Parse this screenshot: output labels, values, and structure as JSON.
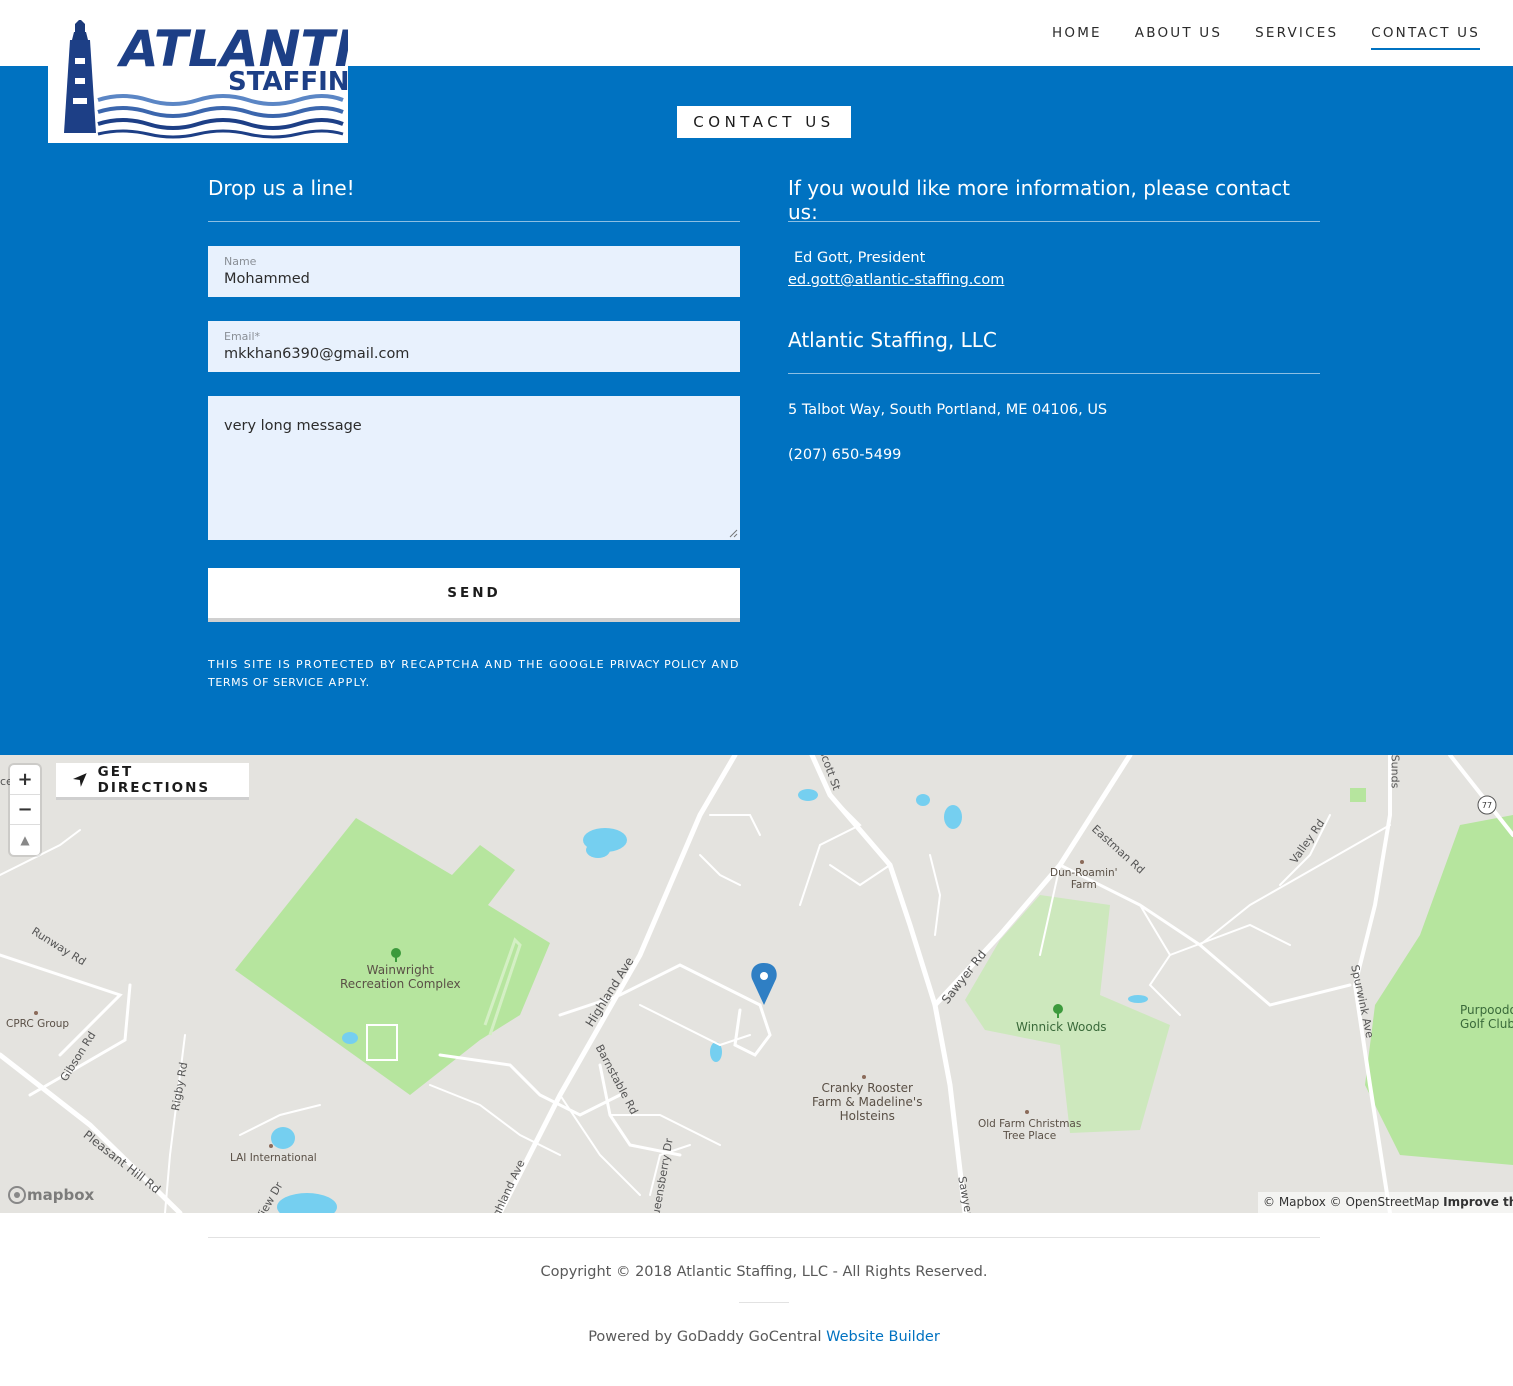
{
  "brand": {
    "logo_line1": "ATLANTIC",
    "logo_line2": "STAFFING"
  },
  "nav": {
    "items": [
      {
        "label": "HOME",
        "active": false
      },
      {
        "label": "ABOUT US",
        "active": false
      },
      {
        "label": "SERVICES",
        "active": false
      },
      {
        "label": "CONTACT US",
        "active": true
      }
    ]
  },
  "colors": {
    "accent": "#0072c1",
    "field_bg": "#e8f1fd",
    "park_green": "#b6e59e",
    "water_blue": "#75cff0"
  },
  "contact": {
    "section_title": "CONTACT US",
    "form": {
      "heading": "Drop us a line!",
      "name_label": "Name",
      "name_value": "Mohammed",
      "email_label": "Email*",
      "email_value": "mkkhan6390@gmail.com",
      "message_value": "very long message",
      "send_label": "SEND",
      "recaptcha_prefix": "This site is protected by reCAPTCHA and the Google",
      "privacy_link": "Privacy Policy",
      "and_text": "and",
      "terms_link": "Terms of Service",
      "recaptcha_suffix": "apply."
    },
    "info": {
      "heading": "If you would like more information, please contact us:",
      "person": " Ed Gott, President",
      "email": "ed.gott@atlantic-staffing.com",
      "company_heading": "Atlantic Staffing, LLC",
      "address": "5 Talbot Way, South Portland, ME 04106, US",
      "phone": "(207) 650-5499"
    }
  },
  "map": {
    "zoom_in": "+",
    "zoom_out": "−",
    "compass": "▲",
    "directions_label": "GET DIRECTIONS",
    "directions_icon": "navigation-arrow-icon",
    "mapbox_logo": "mapbox",
    "attribution_mapbox": "© Mapbox",
    "attribution_osm": "© OpenStreetMap",
    "attribution_improve": "Improve this map",
    "places": {
      "wainwright": "Wainwright\nRecreation Complex",
      "winnick": "Winnick Woods",
      "cranky": "Cranky Rooster\nFarm & Madeline's\nHolsteins",
      "dun": "Dun-Roamin'\nFarm",
      "oldfarm": "Old Farm Christmas\nTree Place",
      "cprc": "CPRC Group",
      "lai": "LAI International",
      "purpoodock": "Purpoodock\nGolf Club"
    },
    "roads": {
      "runway": "Runway Rd",
      "gibson": "Gibson Rd",
      "rigby": "Rigby Rd",
      "pleasant": "Pleasant Hill Rd",
      "highland": "Highland Ave",
      "barnstable": "Barnstable Rd",
      "sawyer": "Sawyer Rd",
      "eastman": "Eastman Rd",
      "valley": "Valley Rd",
      "spurwink": "Spurwink Ave",
      "sawyer2": "Sawyer",
      "queensberry": "Queensberry Dr",
      "highland2": "Highland Ave",
      "viewdr": "View Dr",
      "scott": "Scott St",
      "sunds": "Sunds",
      "route": "77",
      "ce": "ce"
    }
  },
  "footer": {
    "copyright": "Copyright © 2018 Atlantic Staffing, LLC - All Rights Reserved.",
    "powered_prefix": "Powered by GoDaddy GoCentral",
    "powered_link": "Website Builder"
  }
}
